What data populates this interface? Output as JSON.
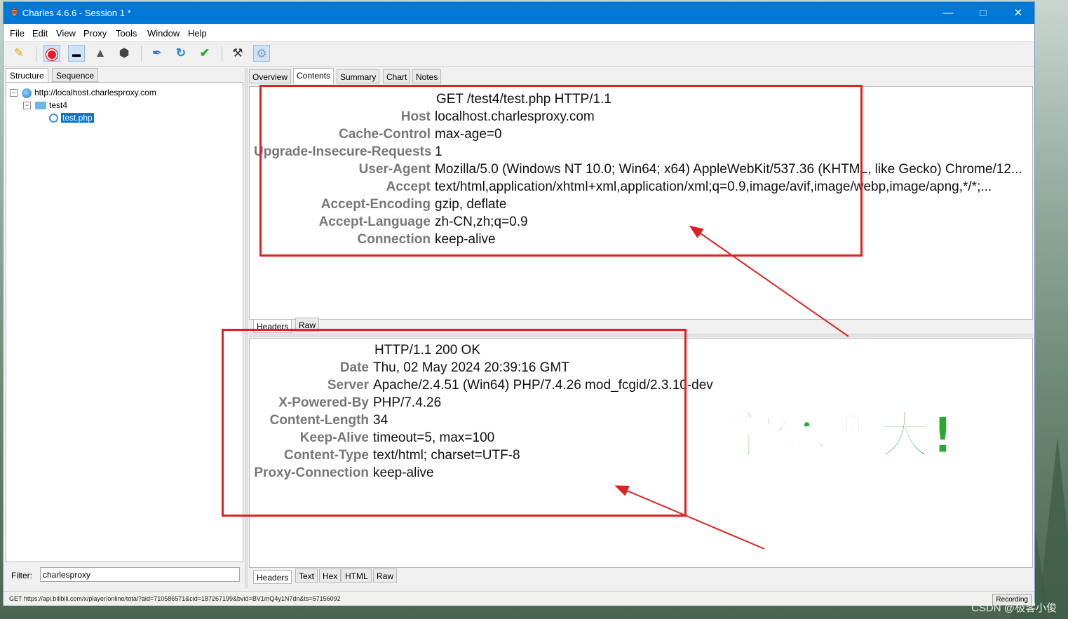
{
  "window": {
    "title": "Charles 4.6.6 - Session 1 *"
  },
  "menu": [
    "File",
    "Edit",
    "View",
    "Proxy",
    "Tools",
    "Window",
    "Help"
  ],
  "toolbar_icons": [
    "broom-icon",
    "record-icon",
    "throttle-icon",
    "turtle-icon",
    "hexagon-stop-icon",
    "pen-icon",
    "refresh-icon",
    "check-icon",
    "tools-icon",
    "gear-icon"
  ],
  "left": {
    "tabs": [
      "Structure",
      "Sequence"
    ],
    "tree": {
      "host": "http://localhost.charlesproxy.com",
      "folder": "test4",
      "file": "test.php"
    },
    "filter_label": "Filter:",
    "filter_value": "charlesproxy"
  },
  "right": {
    "tabs": [
      "Overview",
      "Contents",
      "Summary",
      "Chart",
      "Notes"
    ],
    "request": {
      "first_line": "GET /test4/test.php HTTP/1.1",
      "headers": [
        {
          "name": "Host",
          "value": "localhost.charlesproxy.com"
        },
        {
          "name": "Cache-Control",
          "value": "max-age=0"
        },
        {
          "name": "Upgrade-Insecure-Requests",
          "value": "1"
        },
        {
          "name": "User-Agent",
          "value": "Mozilla/5.0 (Windows NT 10.0; Win64; x64) AppleWebKit/537.36 (KHTML, like Gecko) Chrome/12..."
        },
        {
          "name": "Accept",
          "value": "text/html,application/xhtml+xml,application/xml;q=0.9,image/avif,image/webp,image/apng,*/*;..."
        },
        {
          "name": "Accept-Encoding",
          "value": "gzip, deflate"
        },
        {
          "name": "Accept-Language",
          "value": "zh-CN,zh;q=0.9"
        },
        {
          "name": "Connection",
          "value": "keep-alive"
        }
      ],
      "bottom_tabs": [
        "Headers",
        "Raw"
      ]
    },
    "response": {
      "first_line": "HTTP/1.1 200 OK",
      "headers": [
        {
          "name": "Date",
          "value": "Thu, 02 May 2024 20:39:16 GMT"
        },
        {
          "name": "Server",
          "value": "Apache/2.4.51 (Win64) PHP/7.4.26 mod_fcgid/2.3.10-dev"
        },
        {
          "name": "X-Powered-By",
          "value": "PHP/7.4.26"
        },
        {
          "name": "Content-Length",
          "value": "34"
        },
        {
          "name": "Keep-Alive",
          "value": "timeout=5, max=100"
        },
        {
          "name": "Content-Type",
          "value": "text/html; charset=UTF-8"
        },
        {
          "name": "Proxy-Connection",
          "value": "keep-alive"
        }
      ],
      "bottom_tabs": [
        "Headers",
        "Text",
        "Hex",
        "HTML",
        "Raw"
      ]
    }
  },
  "status": {
    "text": "GET https://api.bilibili.com/x/player/online/total?aid=710586571&cid=187267199&bvid=BV1mQ4y1N7dn&ts=57156092",
    "recording": "Recording"
  },
  "annotation": {
    "text": "字体变大!",
    "color": "#2aa834",
    "box_color": "#e02020"
  },
  "watermark": "CSDN @极客小俊"
}
